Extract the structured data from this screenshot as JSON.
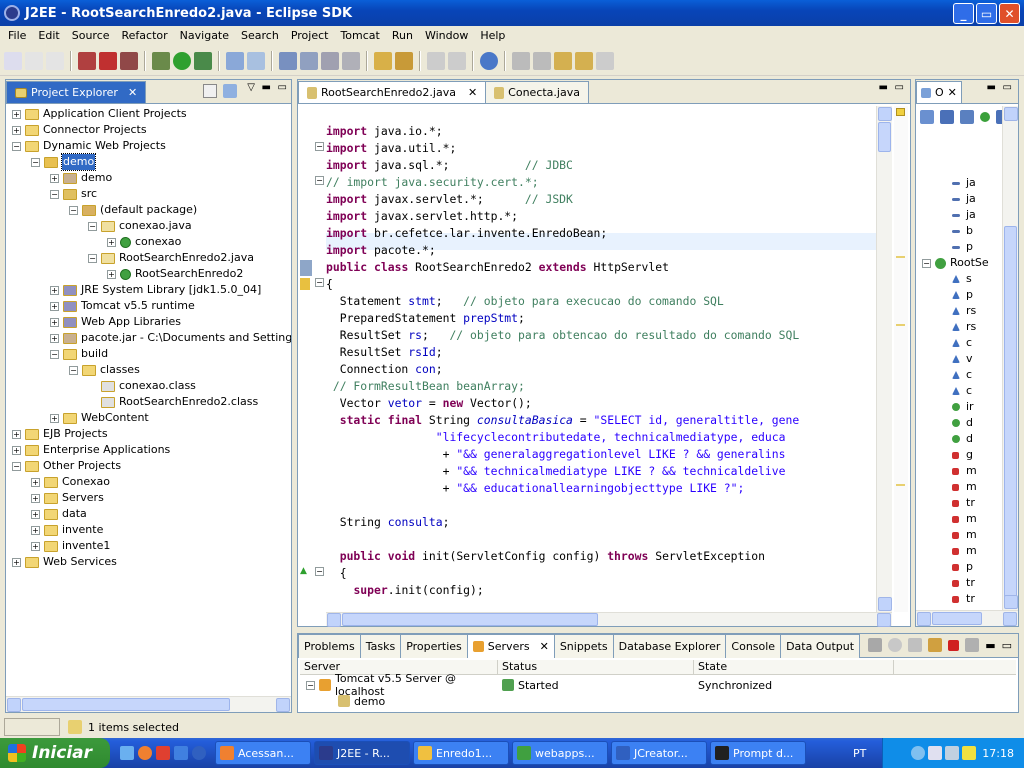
{
  "window": {
    "title": "J2EE - RootSearchEnredo2.java - Eclipse SDK"
  },
  "menu": [
    "File",
    "Edit",
    "Source",
    "Refactor",
    "Navigate",
    "Search",
    "Project",
    "Tomcat",
    "Run",
    "Window",
    "Help"
  ],
  "explorer": {
    "tab_label": "Project Explorer",
    "tree": [
      {
        "label": "Application Client Projects",
        "level": 0,
        "toggle": "+",
        "icon": "folder"
      },
      {
        "label": "Connector Projects",
        "level": 0,
        "toggle": "+",
        "icon": "folder"
      },
      {
        "label": "Dynamic Web Projects",
        "level": 0,
        "toggle": "-",
        "icon": "folder"
      },
      {
        "label": "demo",
        "level": 1,
        "toggle": "-",
        "icon": "project",
        "selected": true
      },
      {
        "label": "demo",
        "level": 2,
        "toggle": "+",
        "icon": "jar"
      },
      {
        "label": "src",
        "level": 2,
        "toggle": "-",
        "icon": "srcfolder"
      },
      {
        "label": "(default package)",
        "level": 3,
        "toggle": "-",
        "icon": "package"
      },
      {
        "label": "conexao.java",
        "level": 4,
        "toggle": "-",
        "icon": "java"
      },
      {
        "label": "conexao",
        "level": 5,
        "toggle": "+",
        "icon": "class"
      },
      {
        "label": "RootSearchEnredo2.java",
        "level": 4,
        "toggle": "-",
        "icon": "java"
      },
      {
        "label": "RootSearchEnredo2",
        "level": 5,
        "toggle": "+",
        "icon": "class"
      },
      {
        "label": "JRE System Library [jdk1.5.0_04]",
        "level": 2,
        "toggle": "+",
        "icon": "lib"
      },
      {
        "label": "Tomcat v5.5 runtime",
        "level": 2,
        "toggle": "+",
        "icon": "lib"
      },
      {
        "label": "Web App Libraries",
        "level": 2,
        "toggle": "+",
        "icon": "lib"
      },
      {
        "label": "pacote.jar - C:\\Documents and Settings\\br",
        "level": 2,
        "toggle": "+",
        "icon": "jar"
      },
      {
        "label": "build",
        "level": 2,
        "toggle": "-",
        "icon": "folder"
      },
      {
        "label": "classes",
        "level": 3,
        "toggle": "-",
        "icon": "folder"
      },
      {
        "label": "conexao.class",
        "level": 4,
        "toggle": "",
        "icon": "classfile"
      },
      {
        "label": "RootSearchEnredo2.class",
        "level": 4,
        "toggle": "",
        "icon": "classfile"
      },
      {
        "label": "WebContent",
        "level": 2,
        "toggle": "+",
        "icon": "folder"
      },
      {
        "label": "EJB Projects",
        "level": 0,
        "toggle": "+",
        "icon": "folder"
      },
      {
        "label": "Enterprise Applications",
        "level": 0,
        "toggle": "+",
        "icon": "folder"
      },
      {
        "label": "Other Projects",
        "level": 0,
        "toggle": "-",
        "icon": "folder"
      },
      {
        "label": "Conexao",
        "level": 1,
        "toggle": "+",
        "icon": "folder"
      },
      {
        "label": "Servers",
        "level": 1,
        "toggle": "+",
        "icon": "folder"
      },
      {
        "label": "data",
        "level": 1,
        "toggle": "+",
        "icon": "folder"
      },
      {
        "label": "invente",
        "level": 1,
        "toggle": "+",
        "icon": "folder"
      },
      {
        "label": "invente1",
        "level": 1,
        "toggle": "+",
        "icon": "folder"
      },
      {
        "label": "Web Services",
        "level": 0,
        "toggle": "+",
        "icon": "folder"
      }
    ]
  },
  "editor": {
    "tabs": [
      "RootSearchEnredo2.java",
      "Conecta.java"
    ],
    "code": [
      "",
      "[[k:import]] java.io.*;",
      "[[k:import]] java.util.*;",
      "[[k:import]] java.sql.*;           [[c:// JDBC]]",
      "[[c:// import java.security.cert.*;]]",
      "[[k:import]] javax.servlet.*;      [[c:// JSDK]]",
      "[[k:import]] javax.servlet.http.*;",
      "[[k:import]] br.cefetce.lar.invente.EnredoBean;",
      "[[k:import]] pacote.*;",
      "[[k:public]] [[k:class]] RootSearchEnredo2 [[k:extends]] HttpServlet",
      "{",
      "  Statement [[f:stmt]];   [[c:// objeto para execucao do comando SQL]]",
      "  PreparedStatement [[f:prepStmt]];",
      "  ResultSet [[f:rs]];   [[c:// objeto para obtencao do resultado do comando SQL]]",
      "  ResultSet [[f:rsId]];",
      "  Connection [[f:con]];",
      " [[c:// FormResultBean beanArray;]]",
      "  Vector [[f:vetor]] = [[k:new]] Vector();",
      "  [[k:static]] [[k:final]] String [[i:consultaBasica]] = [[s:\"SELECT id, generaltitle, gene]]",
      "                [[s:\"lifecyclecontributedate, technicalmediatype, educa]]",
      "                 + [[s:\"&& generalaggregationlevel LIKE ? && generalins]]",
      "                 + [[s:\"&& technicalmediatype LIKE ? && technicaldelive]]",
      "                 + [[s:\"&& educationallearningobjecttype LIKE ?\";]]",
      "",
      "  String [[f:consulta]];",
      "",
      "  [[k:public]] [[k:void]] init(ServletConfig config) [[k:throws]] ServletException",
      "  {",
      "    [[k:super]].init(config);"
    ]
  },
  "outline": {
    "tab_label": "O",
    "root_label": "RootSe",
    "items": [
      "ja",
      "ja",
      "ja",
      "b",
      "p",
      "s",
      "p",
      "rs",
      "rs",
      "c",
      "v",
      "c",
      "c",
      "ir",
      "d",
      "d",
      "g",
      "m",
      "m",
      "tr",
      "m",
      "m",
      "m",
      "p",
      "tr",
      "tr"
    ]
  },
  "bottom": {
    "tabs": [
      "Problems",
      "Tasks",
      "Properties",
      "Servers",
      "Snippets",
      "Database Explorer",
      "Console",
      "Data Output"
    ],
    "active_tab": "Servers",
    "columns": [
      "Server",
      "Status",
      "State"
    ],
    "rows": [
      {
        "server": "Tomcat v5.5 Server @ localhost",
        "status": "Started",
        "state": "Synchronized"
      },
      {
        "server": "demo",
        "status": "",
        "state": ""
      }
    ]
  },
  "status": {
    "text": "1 items selected"
  },
  "taskbar": {
    "start_label": "Iniciar",
    "tasks": [
      "Acessan...",
      "J2EE - R...",
      "Enredo1...",
      "webapps...",
      "JCreator...",
      "Prompt d..."
    ],
    "lang": "PT",
    "clock": "17:18"
  }
}
